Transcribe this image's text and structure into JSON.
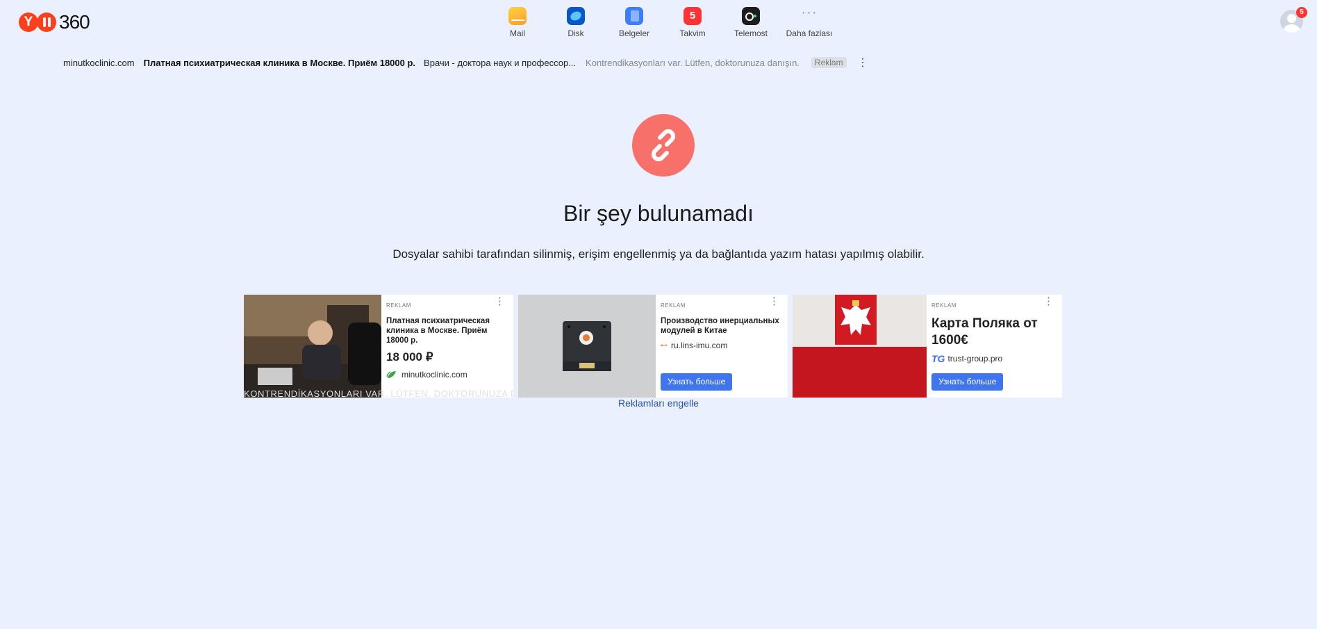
{
  "header": {
    "logo_text": "360",
    "services": [
      {
        "label": "Mail",
        "icon": "mail-icon"
      },
      {
        "label": "Disk",
        "icon": "disk-icon"
      },
      {
        "label": "Belgeler",
        "icon": "documents-icon"
      },
      {
        "label": "Takvim",
        "icon": "calendar-icon",
        "badge": "5"
      },
      {
        "label": "Telemost",
        "icon": "telemost-icon"
      },
      {
        "label": "Daha fazlası",
        "icon": "more-icon",
        "glyph": "···"
      }
    ],
    "avatar_badge": "5"
  },
  "top_ad": {
    "domain": "minutkoclinic.com",
    "title": "Платная психиатрическая клиника в Москве. Приём 18000 р.",
    "description": "Врачи - доктора наук и профессор...",
    "warning": "Kontrendikasyonları var. Lütfen, doktorunuza danışın.",
    "badge": "Reklam",
    "menu": "⋮"
  },
  "error": {
    "title": "Bir şey bulunamadı",
    "description": "Dosyalar sahibi tarafından silinmiş, erişim engellenmiş ya da bağlantıda yazım hatası yapılmış olabilir."
  },
  "ads": [
    {
      "tag": "REKLAM",
      "title": "Платная психиатрическая клиника в Москве. Приём 18000 р.",
      "price": "18 000 ₽",
      "domain": "minutkoclinic.com",
      "disclaimer": "KONTRENDİKASYONLARI VAR. LÜTFEN, DOKTORUNUZA DANIŞIN"
    },
    {
      "tag": "REKLAM",
      "title": "Производство инерциальных модулей в Китае",
      "domain": "ru.lins-imu.com",
      "cta": "Узнать больше"
    },
    {
      "tag": "REKLAM",
      "title": "Карта Поляка от 1600€",
      "domain": "trust-group.pro",
      "cta": "Узнать больше"
    }
  ],
  "block_ads_link": "Reklamları engelle",
  "colors": {
    "accent": "#fc3f1d",
    "background": "#eaf0fd",
    "error_circle": "#f7706a",
    "button": "#3f76f0",
    "link": "#2b54b3"
  }
}
